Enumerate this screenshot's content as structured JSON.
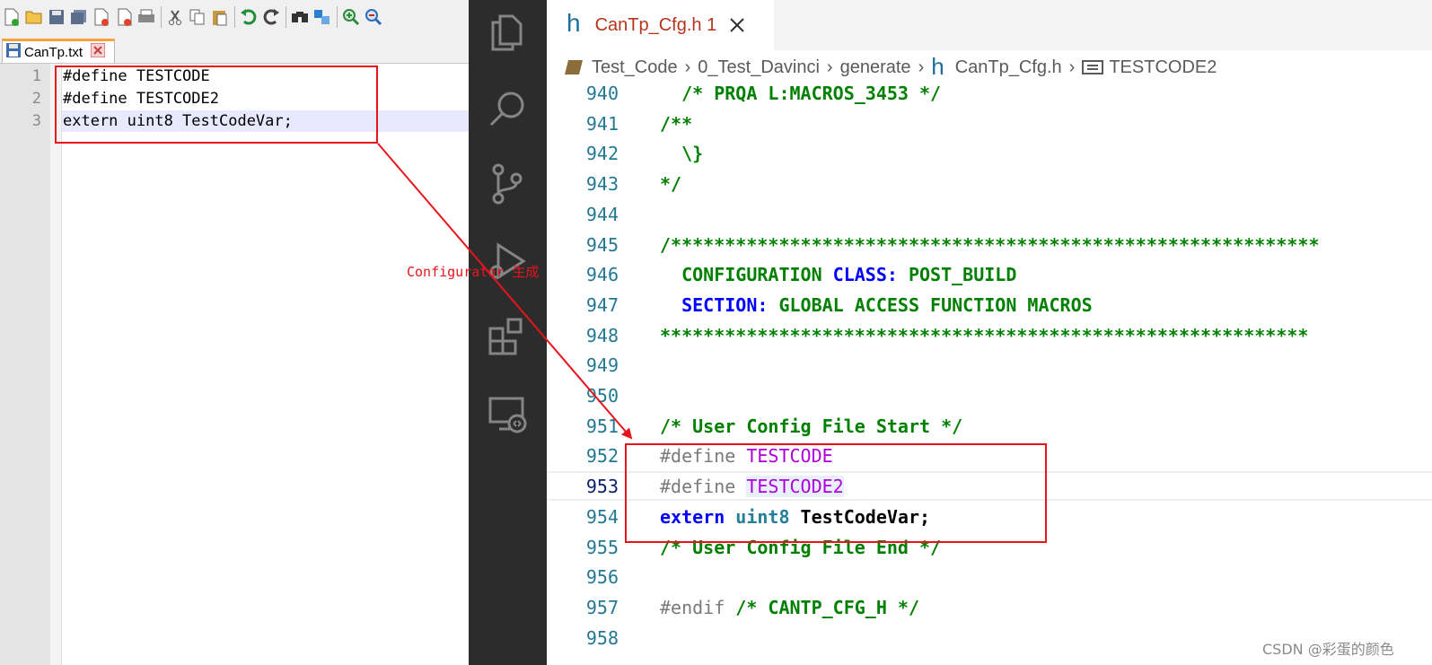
{
  "npp": {
    "toolbar_icons": [
      "new-file-icon",
      "open-file-icon",
      "save-icon",
      "save-all-icon",
      "close-icon",
      "close-all-icon",
      "print-icon",
      "cut-icon",
      "copy-icon",
      "paste-icon",
      "undo-icon",
      "redo-icon",
      "find-icon",
      "replace-icon",
      "zoom-in-icon",
      "zoom-out-icon"
    ],
    "tab_label": "CanTp.txt",
    "lines": [
      {
        "num": "1",
        "text": "#define TESTCODE"
      },
      {
        "num": "2",
        "text": "#define TESTCODE2"
      },
      {
        "num": "3",
        "text": "extern uint8 TestCodeVar;"
      }
    ]
  },
  "vscode": {
    "activity_icons": [
      "explorer-icon",
      "search-icon",
      "source-control-icon",
      "run-debug-icon",
      "extensions-icon",
      "remote-explorer-icon"
    ],
    "tab": {
      "icon": "h",
      "title": "CanTp_Cfg.h 1"
    },
    "breadcrumb": {
      "folder": "Test_Code",
      "sub1": "0_Test_Davinci",
      "sub2": "generate",
      "file_icon": "h",
      "file": "CanTp_Cfg.h",
      "symbol": "TESTCODE2"
    },
    "lines": [
      {
        "num": "940",
        "t1": "  /* PRQA L:MACROS_3453 */"
      },
      {
        "num": "941",
        "t1": "/**"
      },
      {
        "num": "942",
        "t1": "  \\}"
      },
      {
        "num": "943",
        "t1": "*/"
      },
      {
        "num": "944",
        "t1": ""
      },
      {
        "num": "945",
        "t1": "/************************************************************"
      },
      {
        "num": "946",
        "t1": "  CONFIGURATION ",
        "t2": "CLASS:",
        "t3": " POST_BUILD"
      },
      {
        "num": "947",
        "t1": "  ",
        "t2": "SECTION:",
        "t3": " GLOBAL ACCESS FUNCTION MACROS"
      },
      {
        "num": "948",
        "t1": "************************************************************"
      },
      {
        "num": "949",
        "t1": ""
      },
      {
        "num": "950",
        "t1": ""
      },
      {
        "num": "951",
        "t1": "/* User Config File Start */"
      },
      {
        "num": "952",
        "t1": "#define ",
        "t2": "TESTCODE"
      },
      {
        "num": "953",
        "t1": "#define ",
        "t2": "TESTCODE2"
      },
      {
        "num": "954",
        "t1": "extern",
        "t2": " uint8",
        "t3": " TestCodeVar;"
      },
      {
        "num": "955",
        "t1": "/* User Config File End */"
      },
      {
        "num": "956",
        "t1": ""
      },
      {
        "num": "957",
        "t1": "#endif",
        "t2": " /* CANTP_CFG_H */"
      },
      {
        "num": "958",
        "t1": ""
      }
    ]
  },
  "annotation": {
    "label": "Configurator 生成"
  },
  "watermark": "CSDN @彩蛋的颜色",
  "colors": {
    "highlight_red": "#e8141c",
    "activity_bar": "#2c2c2c",
    "tab_title": "#b5351d",
    "comment_green": "#008000",
    "keyword_blue": "#0000ff",
    "macro_purple": "#af00db"
  }
}
